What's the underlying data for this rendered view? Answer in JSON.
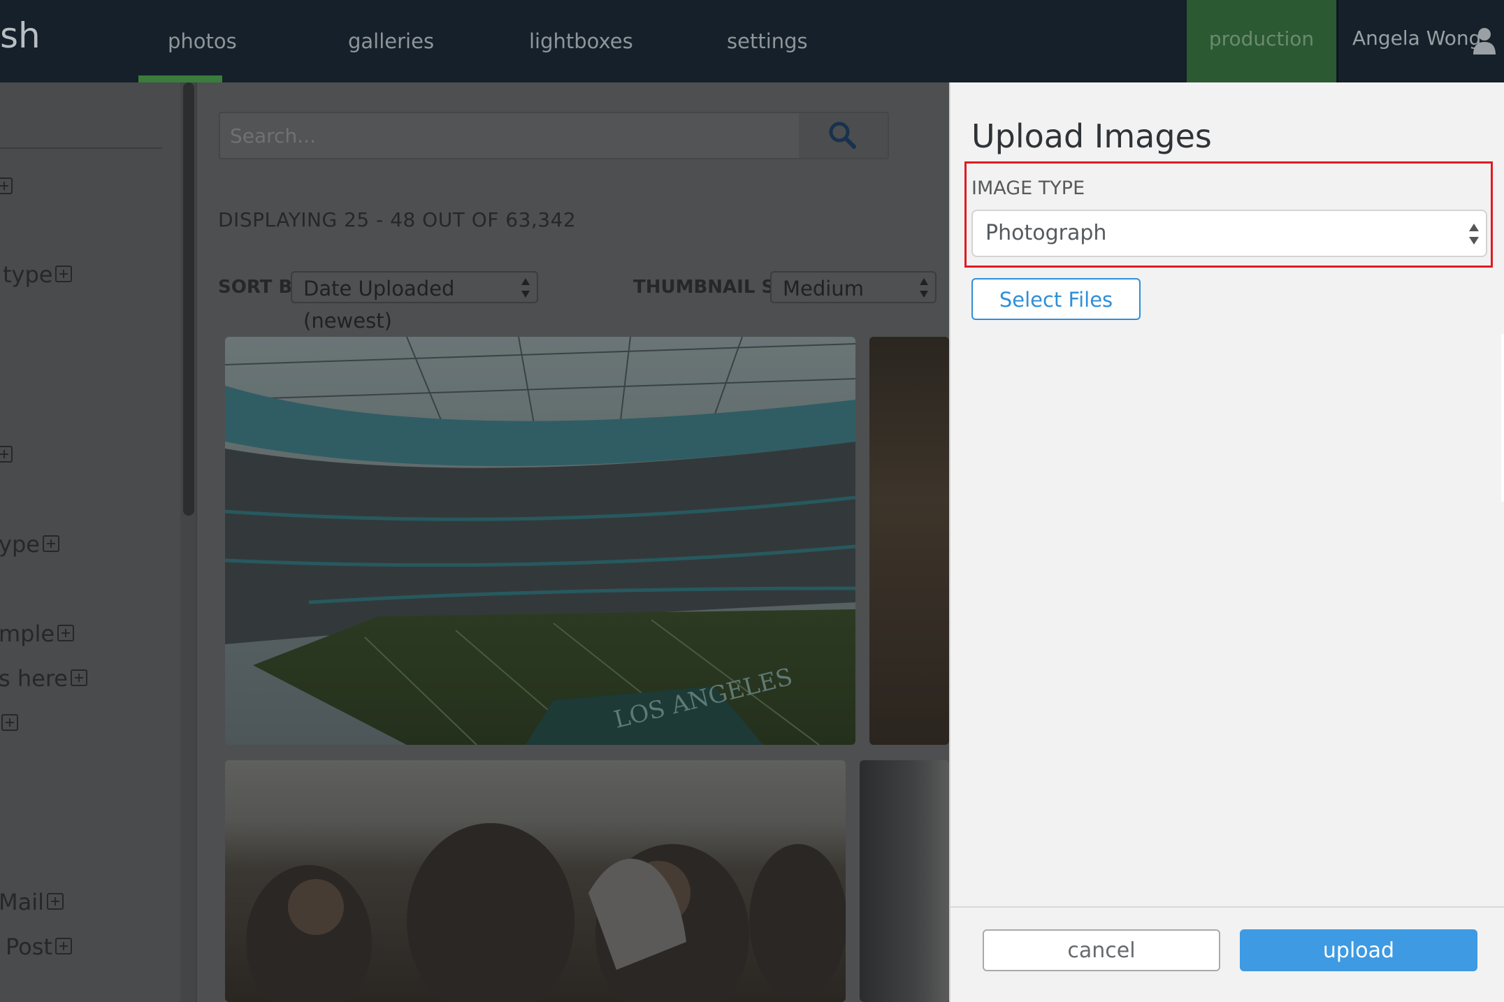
{
  "topnav": {
    "brand": "sh",
    "items": [
      {
        "label": "photos",
        "active": true
      },
      {
        "label": "galleries"
      },
      {
        "label": "lightboxes"
      },
      {
        "label": "settings"
      }
    ],
    "environment": "production",
    "user": "Angela Wong",
    "user_icon": "user-icon"
  },
  "sidebar": {
    "items": [
      {
        "label": ""
      },
      {
        "label": "type"
      },
      {
        "label": ""
      },
      {
        "label": "ype"
      },
      {
        "label": "mple"
      },
      {
        "label": "s here"
      },
      {
        "label": ""
      },
      {
        "label": "Mail"
      },
      {
        "label": "Post"
      }
    ]
  },
  "main": {
    "search": {
      "placeholder": "Search...",
      "icon": "search-icon"
    },
    "displaying": "DISPLAYING 25 - 48 OUT OF 63,342",
    "sort_label": "SORT BY:",
    "sort_value": "Date Uploaded (newest)",
    "thumb_label": "THUMBNAIL SIZE:",
    "thumb_value": "Medium",
    "photo_overlay_text": "LOS ANGELES"
  },
  "modal": {
    "title": "Upload Images",
    "image_type_label": "IMAGE TYPE",
    "image_type_value": "Photograph",
    "select_files": "Select Files",
    "cancel": "cancel",
    "upload": "upload"
  },
  "colors": {
    "nav_bg": "#15202a",
    "env_bg": "#2b5931",
    "accent_blue": "#3d9ae3",
    "highlight_red": "#e11b22"
  }
}
